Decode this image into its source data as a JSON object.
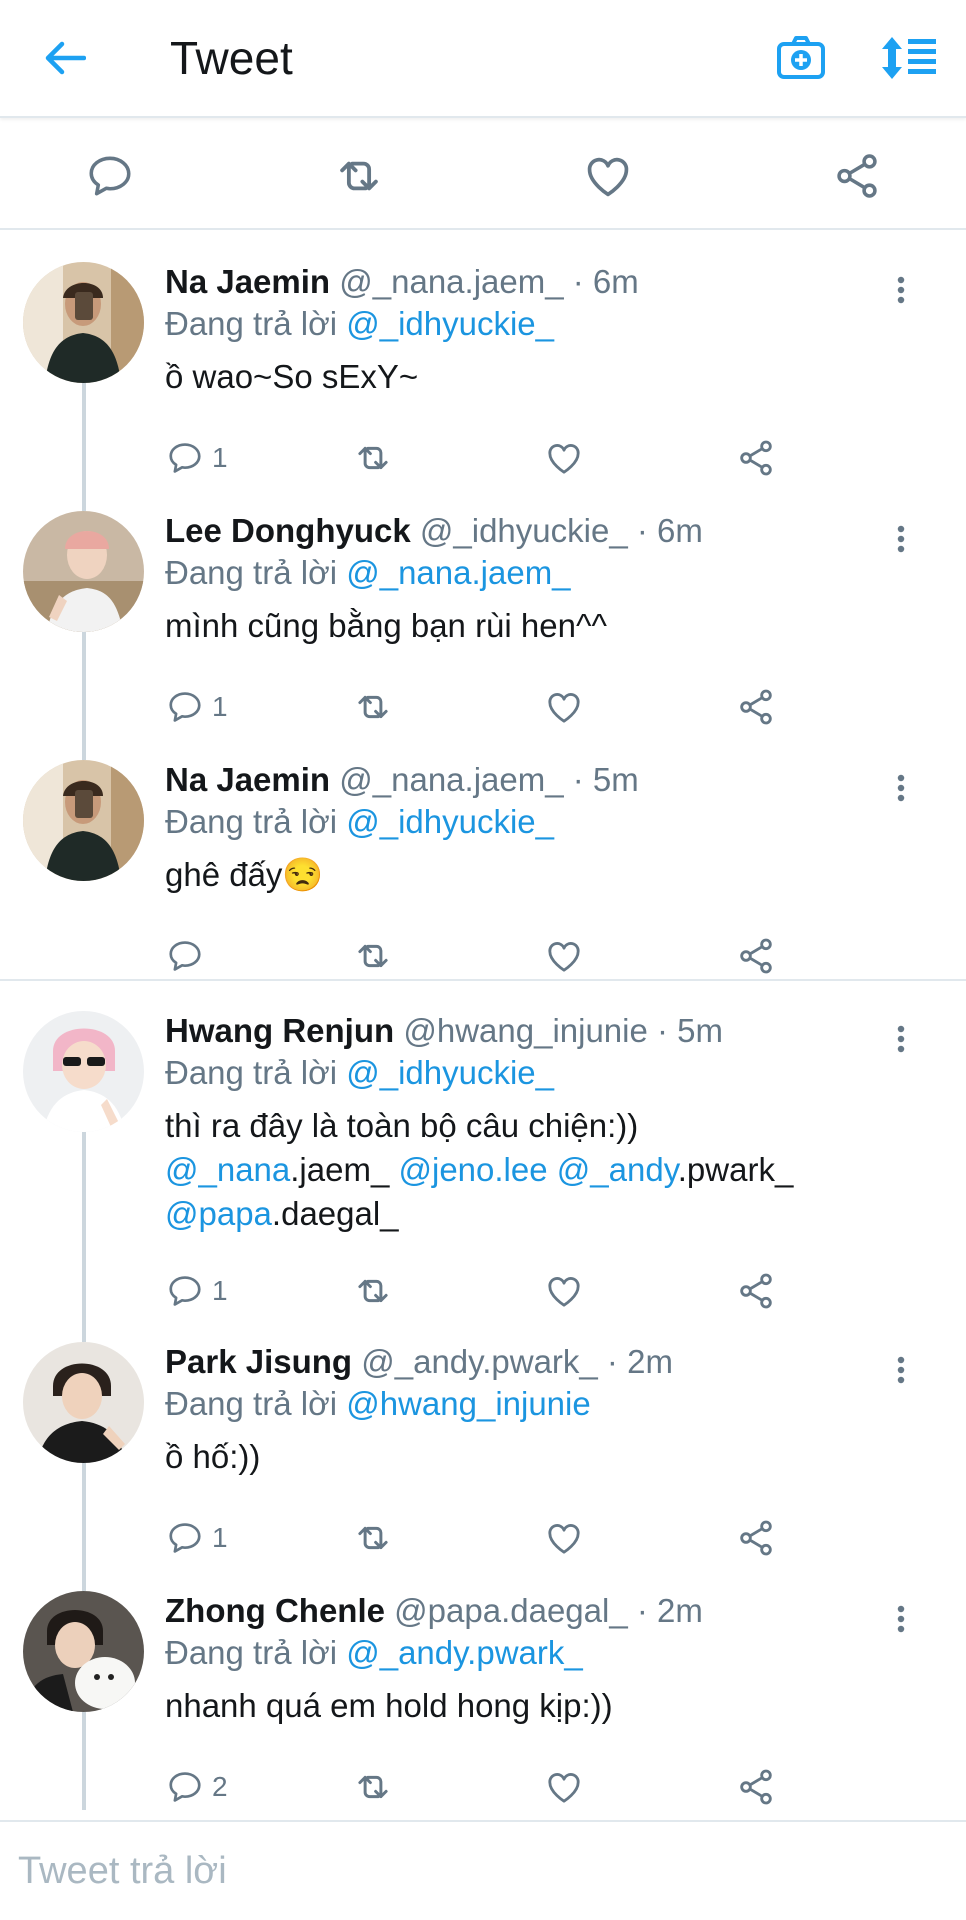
{
  "header": {
    "title": "Tweet",
    "back_icon": "arrow-left-icon",
    "camera_icon": "camera-plus-icon",
    "sort_icon": "sort-list-icon",
    "accent": "#1da1f2"
  },
  "tweet_actions": [
    "reply-icon",
    "retweet-icon",
    "like-icon",
    "share-icon"
  ],
  "replies": [
    {
      "name": "Na Jaemin",
      "handle_time": "@_nana.jaem_ · 6m",
      "replying_label": "Đang trả lời",
      "replying_to": "@_idhyuckie_",
      "text": "ồ wao~So sExY~",
      "reply_count": "1"
    },
    {
      "name": "Lee Donghyuck",
      "handle_time": "@_idhyuckie_ · 6m",
      "replying_label": "Đang trả lời",
      "replying_to": "@_nana.jaem_",
      "text": "mình cũng bằng bạn rùi hen^^",
      "reply_count": "1"
    },
    {
      "name": "Na Jaemin",
      "handle_time": "@_nana.jaem_ · 5m",
      "replying_label": "Đang trả lời",
      "replying_to": "@_idhyuckie_",
      "text": "ghê đấy😒",
      "reply_count": ""
    },
    {
      "name": "Hwang Renjun",
      "handle_time": "@hwang_injunie · 5m",
      "replying_label": "Đang trả lời",
      "replying_to": "@_idhyuckie_",
      "text_line1": "thì ra đây là toàn bộ câu chiện:))",
      "m1_link": "@_nana",
      "m1_rest": ".jaem_",
      "m2_link": "@jeno.lee",
      "m3_link": "@_andy",
      "m3_rest": ".pwark_",
      "m4_link": "@papa",
      "m4_rest": ".daegal_",
      "reply_count": "1"
    },
    {
      "name": "Park Jisung",
      "handle_time": "@_andy.pwark_ · 2m",
      "replying_label": "Đang trả lời",
      "replying_to": "@hwang_injunie",
      "text": "ồ hố:))",
      "reply_count": "1"
    },
    {
      "name": "Zhong Chenle",
      "handle_time": "@papa.daegal_ · 2m",
      "replying_label": "Đang trả lời",
      "replying_to": "@_andy.pwark_",
      "text": "nhanh quá em hold hong kịp:))",
      "reply_count": "2"
    }
  ],
  "compose": {
    "placeholder": "Tweet trả lời"
  }
}
